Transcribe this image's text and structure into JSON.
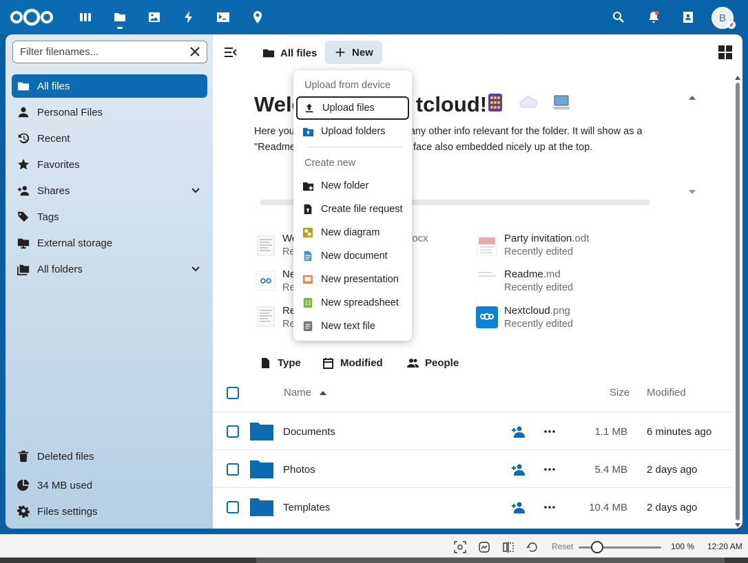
{
  "header": {
    "avatar_initial": "B",
    "apps": [
      "dashboard-icon",
      "files-icon",
      "photos-icon",
      "activity-icon",
      "terminal-icon",
      "maps-icon"
    ],
    "right_icons": [
      "search-icon",
      "notifications-icon",
      "contacts-icon"
    ]
  },
  "sidebar": {
    "filter_placeholder": "Filter filenames...",
    "items": [
      {
        "label": "All files",
        "icon": "folder-icon"
      },
      {
        "label": "Personal Files",
        "icon": "person-icon"
      },
      {
        "label": "Recent",
        "icon": "history-icon"
      },
      {
        "label": "Favorites",
        "icon": "star-icon"
      },
      {
        "label": "Shares",
        "icon": "share-icon"
      },
      {
        "label": "Tags",
        "icon": "tag-icon"
      },
      {
        "label": "External storage",
        "icon": "storage-icon"
      },
      {
        "label": "All folders",
        "icon": "folders-icon"
      }
    ],
    "footer": {
      "deleted": "Deleted files",
      "quota": "34 MB used",
      "settings": "Files settings"
    }
  },
  "toolbar": {
    "breadcrumb": "All files",
    "new_label": "New"
  },
  "readme": {
    "title_start": "Welc",
    "title_end": "tcloud!",
    "line1_start": "Here you",
    "line1_end": "any other info relevant for the folder. It will show as a",
    "line2_start": "\"Readme",
    "line2_end": "face also embedded nicely up at the top."
  },
  "recent_files": [
    {
      "name": "We",
      "ext": "ocx",
      "sub": "Re"
    },
    {
      "name": "Ne",
      "sub": "Re"
    },
    {
      "name": "Re",
      "sub": "Re"
    },
    {
      "name": "Party invitation",
      "ext": ".odt",
      "sub": "Recently edited"
    },
    {
      "name": "Readme",
      "ext": ".md",
      "sub": "Recently edited"
    },
    {
      "name": "Nextcloud",
      "ext": ".png",
      "sub": "Recently edited"
    }
  ],
  "filters": [
    "Type",
    "Modified",
    "People"
  ],
  "table": {
    "headers": {
      "name": "Name",
      "size": "Size",
      "modified": "Modified"
    },
    "rows": [
      {
        "name": "Documents",
        "size": "1.1 MB",
        "modified": "6 minutes ago"
      },
      {
        "name": "Photos",
        "size": "5.4 MB",
        "modified": "2 days ago"
      },
      {
        "name": "Templates",
        "size": "10.4 MB",
        "modified": "2 days ago"
      }
    ]
  },
  "menu": {
    "section_upload": "Upload from device",
    "upload_files": "Upload files",
    "upload_folders": "Upload folders",
    "section_create": "Create new",
    "items": [
      {
        "label": "New folder",
        "icon": "new-folder-icon"
      },
      {
        "label": "Create file request",
        "icon": "file-request-icon"
      },
      {
        "label": "New diagram",
        "icon": "diagram-icon",
        "color": "#b8a11a"
      },
      {
        "label": "New document",
        "icon": "document-icon",
        "color": "#4a90d9"
      },
      {
        "label": "New presentation",
        "icon": "presentation-icon",
        "color": "#e9834a"
      },
      {
        "label": "New spreadsheet",
        "icon": "spreadsheet-icon",
        "color": "#7cb342"
      },
      {
        "label": "New text file",
        "icon": "text-file-icon",
        "color": "#777777"
      }
    ]
  },
  "taskbar": {
    "reset": "Reset",
    "zoom": "100 %",
    "time": "12:20 AM"
  },
  "colors": {
    "brand": "#0b6cb3",
    "header": "#0a62a6"
  }
}
